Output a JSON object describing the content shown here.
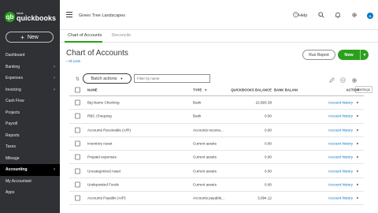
{
  "sidebar": {
    "logo_mark": "qb",
    "logo_brand": "intuit",
    "logo_name": "quickbooks",
    "new_label": "New",
    "items": [
      {
        "label": "Dashboard",
        "chevron": false,
        "active": false
      },
      {
        "label": "Banking",
        "chevron": true,
        "active": false
      },
      {
        "label": "Expenses",
        "chevron": true,
        "active": false
      },
      {
        "label": "Invoicing",
        "chevron": true,
        "active": false
      },
      {
        "label": "Cash Flow",
        "chevron": false,
        "active": false
      },
      {
        "label": "Projects",
        "chevron": false,
        "active": false
      },
      {
        "label": "Payroll",
        "chevron": false,
        "active": false
      },
      {
        "label": "Reports",
        "chevron": false,
        "active": false
      },
      {
        "label": "Taxes",
        "chevron": false,
        "active": false
      },
      {
        "label": "Mileage",
        "chevron": false,
        "active": false
      },
      {
        "label": "Accounting",
        "chevron": true,
        "active": true
      },
      {
        "label": "My Accountant",
        "chevron": false,
        "active": false
      },
      {
        "label": "Apps",
        "chevron": false,
        "active": false
      }
    ]
  },
  "topbar": {
    "company_name": "Green Tree Landscapes",
    "help_label": "Help",
    "avatar_initial": "G"
  },
  "tabs": [
    {
      "label": "Chart of Accounts",
      "active": true
    },
    {
      "label": "Reconcile",
      "active": false
    }
  ],
  "page": {
    "title": "Chart of Accounts",
    "back_link": "All Lists",
    "run_report_label": "Run Report",
    "new_label": "New"
  },
  "toolbar": {
    "batch_actions_label": "Batch actions",
    "filter_placeholder": "Filter by name",
    "settings_tooltip": "Settings"
  },
  "table": {
    "columns": {
      "name": "NAME",
      "type": "TYPE",
      "qb_balance": "QUICKBOOKS BALANCE",
      "bank_balance": "BANK BALANCE",
      "action": "ACTION"
    },
    "rows": [
      {
        "name": "Big Name Checking",
        "type": "Bank",
        "qb_balance": "22,893.38",
        "bank_balance": "",
        "action": "Account history"
      },
      {
        "name": "RBC Chequing",
        "type": "Bank",
        "qb_balance": "0.00",
        "bank_balance": "",
        "action": "Account history"
      },
      {
        "name": "Accounts Receivable (A/R)",
        "type": "Accounts receiva...",
        "qb_balance": "0.00",
        "bank_balance": "",
        "action": "Account history"
      },
      {
        "name": "Inventory Asset",
        "type": "Current assets",
        "qb_balance": "0.00",
        "bank_balance": "",
        "action": "Account history"
      },
      {
        "name": "Prepaid expenses",
        "type": "Current assets",
        "qb_balance": "0.00",
        "bank_balance": "",
        "action": "Account history"
      },
      {
        "name": "Uncategorized Asset",
        "type": "Current assets",
        "qb_balance": "0.00",
        "bank_balance": "",
        "action": "Account history"
      },
      {
        "name": "Undeposited Funds",
        "type": "Current assets",
        "qb_balance": "0.00",
        "bank_balance": "",
        "action": "Account history"
      },
      {
        "name": "Accounts Payable (A/P)",
        "type": "Accounts payable...",
        "qb_balance": "3,094.12",
        "bank_balance": "",
        "action": "Account history"
      }
    ]
  },
  "colors": {
    "sidebar_bg": "#2f3134",
    "accent_green": "#2ca01c",
    "link_blue": "#0077c5"
  },
  "icons": [
    "hamburger-icon",
    "search-icon",
    "bell-icon",
    "gear-icon",
    "help-icon",
    "sort-icon",
    "print-icon",
    "export-icon",
    "settings-gear-icon"
  ]
}
